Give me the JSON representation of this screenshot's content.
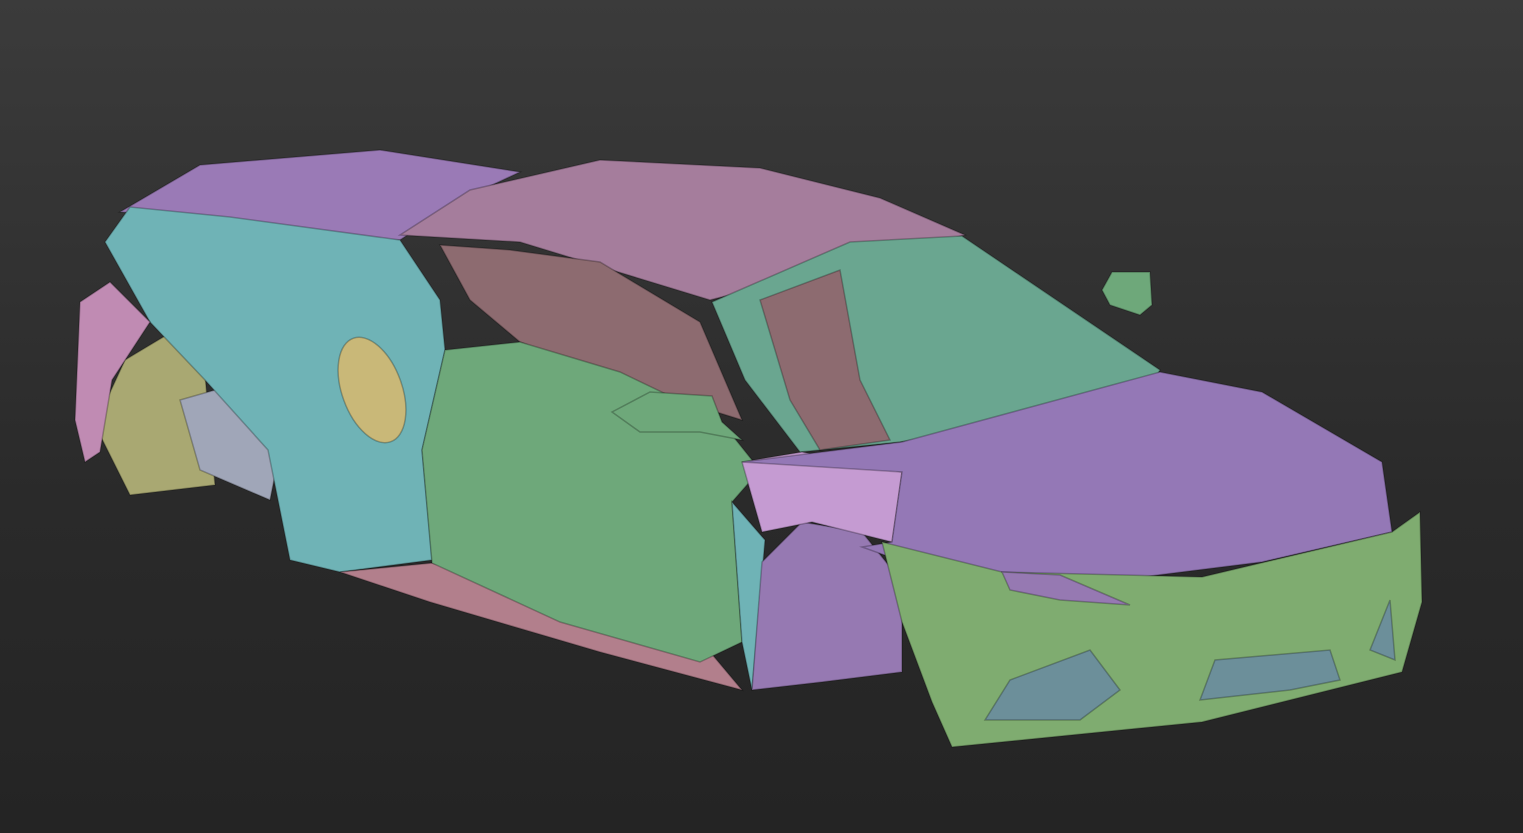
{
  "viewport": {
    "background_top": "#3b3b3b",
    "background_bottom": "#242424"
  },
  "model": {
    "colors": {
      "roof": "#a57d9c",
      "rear_deck": "#9a7ab6",
      "rear_quarter": "#6fb3b6",
      "rear_bumper": "#c08bb3",
      "wheel_arch_rear": "#a9a872",
      "engine_detail": "#a0a6b8",
      "door": "#6ea87a",
      "interior": "#8d6b70",
      "interior_green": "#6aa690",
      "hood": "#9478b6",
      "front_fender": "#c59bd2",
      "front_bumper": "#7fac70",
      "front_arch": "#9679b2",
      "side_sill": "#b27f8c",
      "fuel_cap": "#c9b878",
      "grille": "#6c8f9a"
    }
  }
}
